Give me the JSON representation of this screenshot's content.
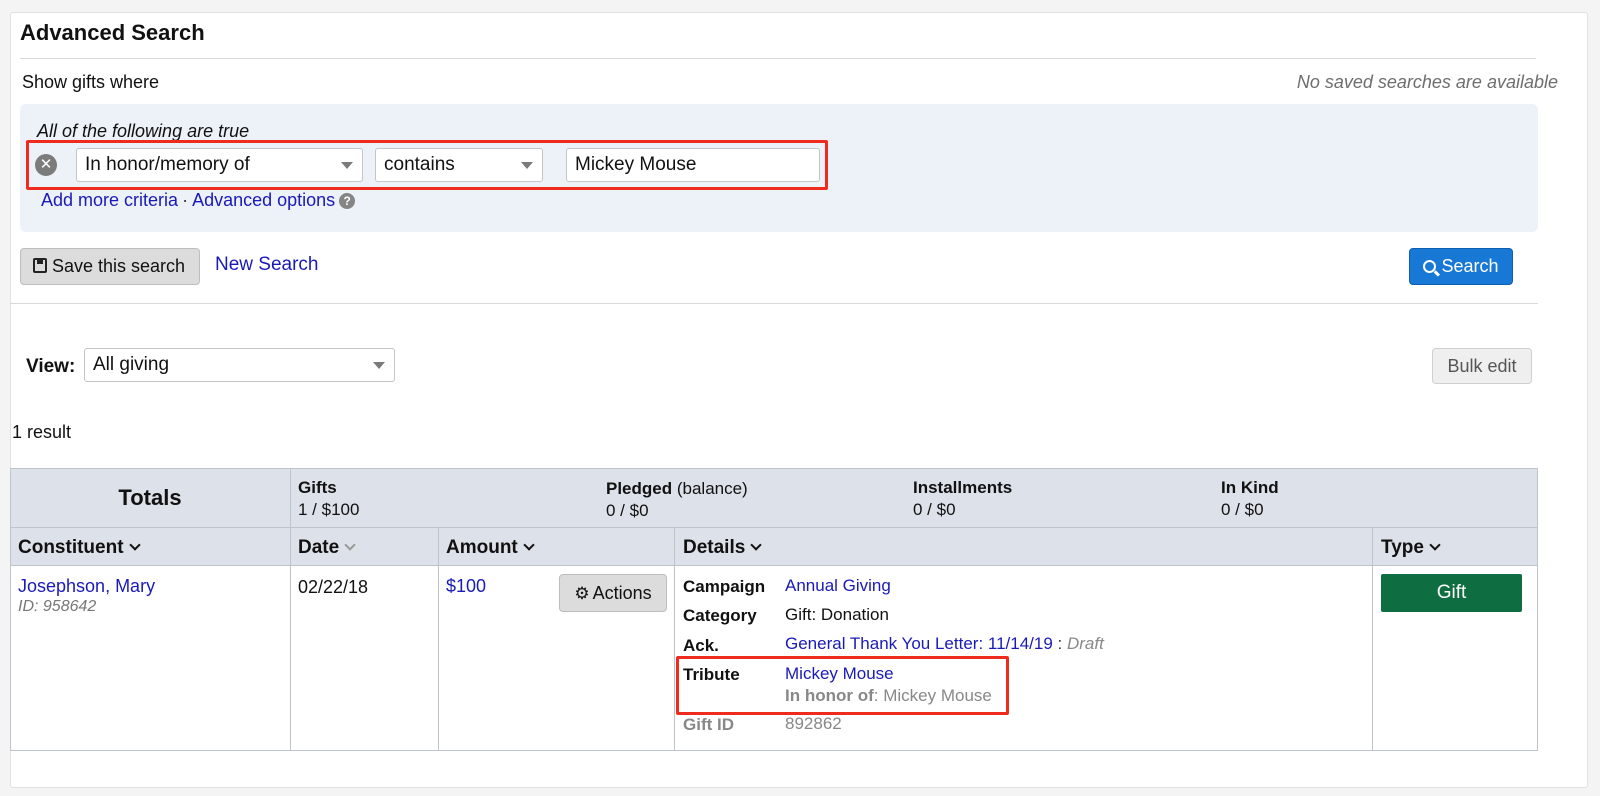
{
  "header": {
    "title": "Advanced Search",
    "show_label": "Show gifts where",
    "saved_searches_note": "No saved searches are available"
  },
  "criteria": {
    "group_label": "All of the following are true",
    "field": "In honor/memory of",
    "operator": "contains",
    "value": "Mickey Mouse",
    "add_more_label": "Add more criteria",
    "separator": "·",
    "advanced_label": "Advanced options",
    "help_glyph": "?"
  },
  "actions": {
    "save_label": "Save this search",
    "new_search_label": "New Search",
    "search_label": "Search"
  },
  "view": {
    "label": "View:",
    "selected": "All giving",
    "bulk_edit_label": "Bulk edit"
  },
  "results": {
    "count_label": "1 result"
  },
  "totals": {
    "label": "Totals",
    "gifts": {
      "label": "Gifts",
      "value": "1 / $100"
    },
    "pledged": {
      "label": "Pledged",
      "sub": " (balance)",
      "value": "0 / $0"
    },
    "installments": {
      "label": "Installments",
      "value": "0 / $0"
    },
    "in_kind": {
      "label": "In Kind",
      "value": "0 / $0"
    }
  },
  "columns": {
    "constituent": "Constituent",
    "date": "Date",
    "amount": "Amount",
    "details": "Details",
    "type": "Type"
  },
  "row": {
    "constituent_name": "Josephson, Mary",
    "constituent_id": "ID: 958642",
    "date": "02/22/18",
    "amount": "$100",
    "actions_label": "Actions",
    "details": {
      "campaign_label": "Campaign",
      "campaign_value": "Annual Giving",
      "category_label": "Category",
      "category_value": "Gift: Donation",
      "ack_label": "Ack.",
      "ack_value": "General Thank You Letter: 11/14/19",
      "ack_separator": " : ",
      "ack_status": "Draft",
      "tribute_label": "Tribute",
      "tribute_name": "Mickey Mouse",
      "tribute_honor_label": "In honor of",
      "tribute_honor_value": ": Mickey Mouse",
      "gift_id_label": "Gift ID",
      "gift_id_value": "892862"
    },
    "type_label": "Gift"
  },
  "colors": {
    "search_button": "#1778d6",
    "gift_badge": "#0f6d42",
    "highlight_box": "#ee2b1c",
    "link": "#1a1ab8",
    "criteria_panel": "#edf1f8"
  }
}
